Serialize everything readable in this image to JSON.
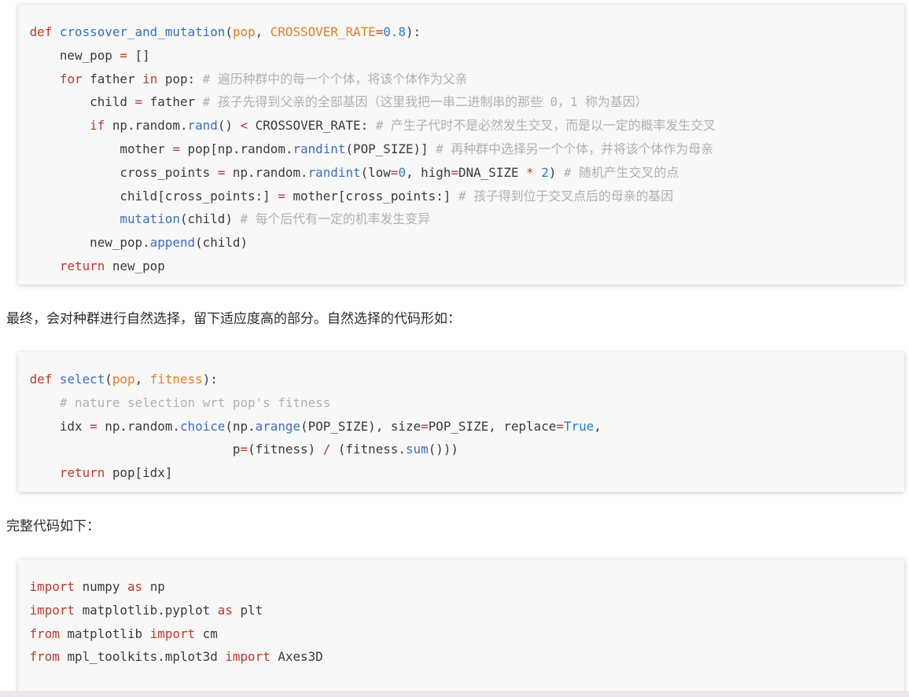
{
  "colors": {
    "keyword": "#c0392b",
    "function": "#3a6fc5",
    "param": "#e67e22",
    "number": "#2a7ed2",
    "comment": "#b0b0b0",
    "text": "#383a42",
    "code_background": "#f8f8f8"
  },
  "prose": {
    "selection_intro": "最终，会对种群进行自然选择，留下适应度高的部分。自然选择的代码形如：",
    "full_code_intro": "完整代码如下："
  },
  "code_blocks": [
    {
      "lines": [
        [
          {
            "t": "def",
            "c": "kw"
          },
          {
            "t": " ",
            "c": "tx"
          },
          {
            "t": "crossover_and_mutation",
            "c": "fn"
          },
          {
            "t": "(",
            "c": "tx"
          },
          {
            "t": "pop",
            "c": "pr"
          },
          {
            "t": ", ",
            "c": "tx"
          },
          {
            "t": "CROSSOVER_RATE",
            "c": "pr"
          },
          {
            "t": "=",
            "c": "op"
          },
          {
            "t": "0.8",
            "c": "nm"
          },
          {
            "t": "):",
            "c": "tx"
          }
        ],
        [
          {
            "t": "    new_pop ",
            "c": "tx"
          },
          {
            "t": "=",
            "c": "op"
          },
          {
            "t": " []",
            "c": "tx"
          }
        ],
        [
          {
            "t": "    ",
            "c": "tx"
          },
          {
            "t": "for",
            "c": "kw"
          },
          {
            "t": " father ",
            "c": "tx"
          },
          {
            "t": "in",
            "c": "kw"
          },
          {
            "t": " pop: ",
            "c": "tx"
          },
          {
            "t": "# 遍历种群中的每一个个体，将该个体作为父亲",
            "c": "cm"
          }
        ],
        [
          {
            "t": "        child ",
            "c": "tx"
          },
          {
            "t": "=",
            "c": "op"
          },
          {
            "t": " father ",
            "c": "tx"
          },
          {
            "t": "# 孩子先得到父亲的全部基因（这里我把一串二进制串的那些 0，1 称为基因）",
            "c": "cm"
          }
        ],
        [
          {
            "t": "        ",
            "c": "tx"
          },
          {
            "t": "if",
            "c": "kw"
          },
          {
            "t": " np.random.",
            "c": "tx"
          },
          {
            "t": "rand",
            "c": "fn"
          },
          {
            "t": "() ",
            "c": "tx"
          },
          {
            "t": "<",
            "c": "op"
          },
          {
            "t": " CROSSOVER_RATE: ",
            "c": "tx"
          },
          {
            "t": "# 产生子代时不是必然发生交叉，而是以一定的概率发生交叉",
            "c": "cm"
          }
        ],
        [
          {
            "t": "            mother ",
            "c": "tx"
          },
          {
            "t": "=",
            "c": "op"
          },
          {
            "t": " pop[np.random.",
            "c": "tx"
          },
          {
            "t": "randint",
            "c": "fn"
          },
          {
            "t": "(POP_SIZE)] ",
            "c": "tx"
          },
          {
            "t": "# 再种群中选择另一个个体，并将该个体作为母亲",
            "c": "cm"
          }
        ],
        [
          {
            "t": "            cross_points ",
            "c": "tx"
          },
          {
            "t": "=",
            "c": "op"
          },
          {
            "t": " np.random.",
            "c": "tx"
          },
          {
            "t": "randint",
            "c": "fn"
          },
          {
            "t": "(low",
            "c": "tx"
          },
          {
            "t": "=",
            "c": "op"
          },
          {
            "t": "0",
            "c": "nm"
          },
          {
            "t": ", high",
            "c": "tx"
          },
          {
            "t": "=",
            "c": "op"
          },
          {
            "t": "DNA_SIZE ",
            "c": "tx"
          },
          {
            "t": "*",
            "c": "op"
          },
          {
            "t": " ",
            "c": "tx"
          },
          {
            "t": "2",
            "c": "nm"
          },
          {
            "t": ") ",
            "c": "tx"
          },
          {
            "t": "# 随机产生交叉的点",
            "c": "cm"
          }
        ],
        [
          {
            "t": "            child[cross_points:] ",
            "c": "tx"
          },
          {
            "t": "=",
            "c": "op"
          },
          {
            "t": " mother[cross_points:] ",
            "c": "tx"
          },
          {
            "t": "# 孩子得到位于交叉点后的母亲的基因",
            "c": "cm"
          }
        ],
        [
          {
            "t": "            ",
            "c": "tx"
          },
          {
            "t": "mutation",
            "c": "fn"
          },
          {
            "t": "(child) ",
            "c": "tx"
          },
          {
            "t": "# 每个后代有一定的机率发生变异",
            "c": "cm"
          }
        ],
        [
          {
            "t": "        new_pop.",
            "c": "tx"
          },
          {
            "t": "append",
            "c": "fn"
          },
          {
            "t": "(child)",
            "c": "tx"
          }
        ],
        [
          {
            "t": "    ",
            "c": "tx"
          },
          {
            "t": "return",
            "c": "kw"
          },
          {
            "t": " new_pop",
            "c": "tx"
          }
        ]
      ]
    },
    {
      "lines": [
        [
          {
            "t": "def",
            "c": "kw"
          },
          {
            "t": " ",
            "c": "tx"
          },
          {
            "t": "select",
            "c": "fn"
          },
          {
            "t": "(",
            "c": "tx"
          },
          {
            "t": "pop",
            "c": "pr"
          },
          {
            "t": ", ",
            "c": "tx"
          },
          {
            "t": "fitness",
            "c": "pr"
          },
          {
            "t": "):",
            "c": "tx"
          }
        ],
        [
          {
            "t": "    ",
            "c": "tx"
          },
          {
            "t": "# nature selection wrt pop's fitness",
            "c": "cm"
          }
        ],
        [
          {
            "t": "    idx ",
            "c": "tx"
          },
          {
            "t": "=",
            "c": "op"
          },
          {
            "t": " np.random.",
            "c": "tx"
          },
          {
            "t": "choice",
            "c": "fn"
          },
          {
            "t": "(np.",
            "c": "tx"
          },
          {
            "t": "arange",
            "c": "fn"
          },
          {
            "t": "(POP_SIZE), size",
            "c": "tx"
          },
          {
            "t": "=",
            "c": "op"
          },
          {
            "t": "POP_SIZE, replace",
            "c": "tx"
          },
          {
            "t": "=",
            "c": "op"
          },
          {
            "t": "True",
            "c": "nm"
          },
          {
            "t": ",",
            "c": "tx"
          }
        ],
        [
          {
            "t": "                           p",
            "c": "tx"
          },
          {
            "t": "=",
            "c": "op"
          },
          {
            "t": "(fitness) ",
            "c": "tx"
          },
          {
            "t": "/",
            "c": "op"
          },
          {
            "t": " (fitness.",
            "c": "tx"
          },
          {
            "t": "sum",
            "c": "fn"
          },
          {
            "t": "()))",
            "c": "tx"
          }
        ],
        [
          {
            "t": "    ",
            "c": "tx"
          },
          {
            "t": "return",
            "c": "kw"
          },
          {
            "t": " pop[idx]",
            "c": "tx"
          }
        ]
      ]
    },
    {
      "lines": [
        [
          {
            "t": "import",
            "c": "kw"
          },
          {
            "t": " numpy ",
            "c": "tx"
          },
          {
            "t": "as",
            "c": "kw"
          },
          {
            "t": " np",
            "c": "tx"
          }
        ],
        [
          {
            "t": "import",
            "c": "kw"
          },
          {
            "t": " matplotlib.pyplot ",
            "c": "tx"
          },
          {
            "t": "as",
            "c": "kw"
          },
          {
            "t": " plt",
            "c": "tx"
          }
        ],
        [
          {
            "t": "from",
            "c": "kw"
          },
          {
            "t": " matplotlib ",
            "c": "tx"
          },
          {
            "t": "import",
            "c": "kw"
          },
          {
            "t": " cm",
            "c": "tx"
          }
        ],
        [
          {
            "t": "from",
            "c": "kw"
          },
          {
            "t": " mpl_toolkits.mplot3d ",
            "c": "tx"
          },
          {
            "t": "import",
            "c": "kw"
          },
          {
            "t": " Axes3D",
            "c": "tx"
          }
        ]
      ]
    }
  ]
}
